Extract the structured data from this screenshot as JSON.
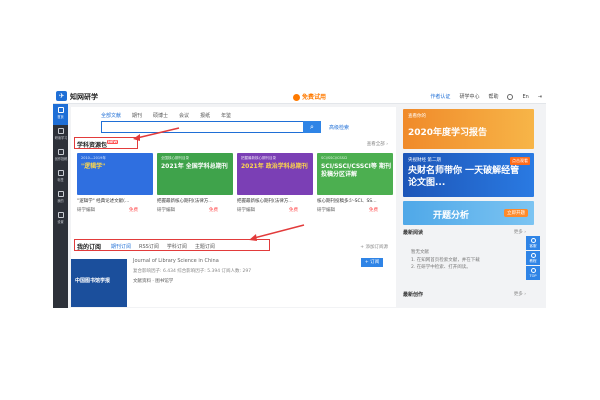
{
  "header": {
    "app_title": "知网研学",
    "trial": "免费试用",
    "links": [
      "作者认证",
      "研学中心",
      "帮助",
      "En"
    ]
  },
  "rail": {
    "items": [
      {
        "label": "首页",
        "active": true
      },
      {
        "label": "研读学习",
        "active": false
      },
      {
        "label": "创作投稿",
        "active": false
      },
      {
        "label": "标签",
        "active": false
      },
      {
        "label": "我的",
        "active": false
      },
      {
        "label": "设置",
        "active": false
      }
    ]
  },
  "search": {
    "tabs": [
      "全部文献",
      "期刊",
      "硕博士",
      "会议",
      "报纸",
      "年鉴"
    ],
    "button_icon": "search-icon",
    "advanced": "高级检索"
  },
  "resources": {
    "title": "学科资源包",
    "badge": "NEW",
    "more": "查看全部 ›",
    "cards": [
      {
        "sub": "2010—2019年",
        "banner": "\"逻辑学\"",
        "caption": "\"逻辑学\" 经典论述文献(…",
        "source": "研学编辑",
        "price": "免费",
        "color": "#2f6fe0"
      },
      {
        "sub": "全国核心期刊目录",
        "banner": "2021年 全国学科总期刊",
        "caption": "把握最新核心期刊(法律方…",
        "source": "研学编辑",
        "price": "免费",
        "color": "#3fa34b"
      },
      {
        "sub": "把握最新核心期刊目录",
        "banner": "2021年 政治学科总期刊",
        "caption": "把握最新核心期刊(法律方…",
        "source": "研学编辑",
        "price": "免费",
        "color": "#7b3fb5"
      },
      {
        "sub": "SCI/SSCI/CSSCI",
        "banner": "SCI/SSCI/CSSCI等 期刊投稿分区详解",
        "caption": "核心期刊投稿多少-SCI、SS…",
        "source": "研学编辑",
        "price": "免费",
        "color": "#4caf50"
      }
    ]
  },
  "subscription": {
    "title": "我的订阅",
    "tabs": [
      "期刊订阅",
      "RSS订阅",
      "学科订阅",
      "主题订阅"
    ],
    "add": "+ 添加订阅源",
    "journal": {
      "cover_text": "中国图书馆学报",
      "title": "Journal of Library Science in China",
      "stats": "复合影响因子: 6.434    综合影响因子: 5.394    订阅人数: 297",
      "line": "文献资料 · 图书馆学",
      "subscribe": "+ 订阅"
    }
  },
  "right": {
    "banner1": {
      "small": "查看你的",
      "big": "2020年度学习报告"
    },
    "banner2": {
      "small": "央视财经 第二期",
      "big": "央财名师带你 一天破解经管论文图...",
      "tag": "点击观看"
    },
    "banner3": {
      "big": "开题分析",
      "button": "立即开题"
    },
    "recent_reading": {
      "title": "最新阅读",
      "more": "更多 ›",
      "empty": "暂无文献",
      "hint1": "1. 在知网首页检索文献，并在下载",
      "hint2": "2. 在研学中检索、打开阅读。"
    },
    "recent_writing": {
      "title": "最新创作",
      "more": "更多 ›"
    }
  },
  "float": [
    "客服",
    "教程",
    "TOP"
  ]
}
